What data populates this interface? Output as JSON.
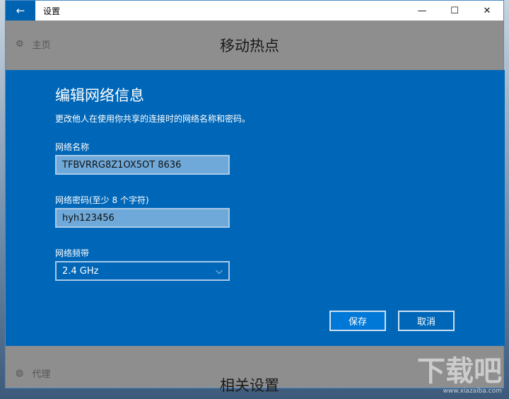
{
  "window": {
    "title": "设置",
    "back": "←",
    "minimize": "—",
    "maximize": "☐",
    "close": "✕"
  },
  "sidebar": {
    "home": "主页",
    "proxy": "代理"
  },
  "main": {
    "heading": "移动热点",
    "related": "相关设置"
  },
  "dialog": {
    "title": "编辑网络信息",
    "description": "更改他人在使用你共享的连接时的网络名称和密码。",
    "name_label": "网络名称",
    "name_value": "TFBVRRG8Z1OX5OT 8636",
    "password_label": "网络密码(至少 8 个字符)",
    "password_value": "hyh123456",
    "band_label": "网络频带",
    "band_value": "2.4 GHz",
    "save": "保存",
    "cancel": "取消"
  },
  "watermark": {
    "text": "下载吧",
    "url": "www.xiazaiba.com"
  }
}
